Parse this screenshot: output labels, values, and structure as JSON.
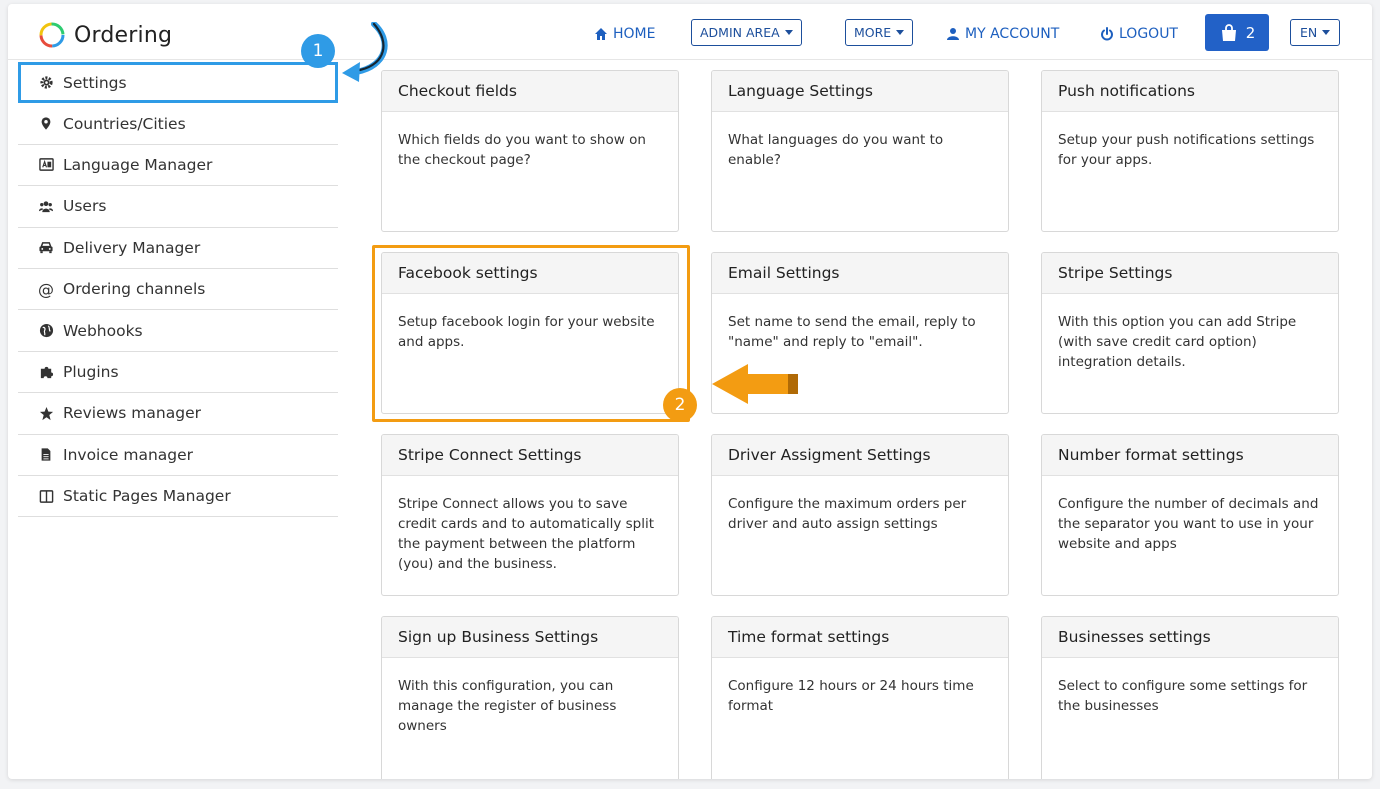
{
  "app": {
    "name": "Ordering"
  },
  "nav": {
    "home": "HOME",
    "admin_area": "ADMIN AREA",
    "more": "MORE",
    "my_account": "MY ACCOUNT",
    "logout": "LOGOUT",
    "cart_count": "2",
    "language": "EN"
  },
  "sidebar": {
    "items": [
      {
        "label": "Settings",
        "icon": "gear-icon"
      },
      {
        "label": "Countries/Cities",
        "icon": "map-marker-icon"
      },
      {
        "label": "Language Manager",
        "icon": "language-icon"
      },
      {
        "label": "Users",
        "icon": "users-icon"
      },
      {
        "label": "Delivery Manager",
        "icon": "car-icon"
      },
      {
        "label": "Ordering channels",
        "icon": "at-icon"
      },
      {
        "label": "Webhooks",
        "icon": "globe-icon"
      },
      {
        "label": "Plugins",
        "icon": "puzzle-icon"
      },
      {
        "label": "Reviews manager",
        "icon": "star-icon"
      },
      {
        "label": "Invoice manager",
        "icon": "file-icon"
      },
      {
        "label": "Static Pages Manager",
        "icon": "columns-icon"
      }
    ]
  },
  "cards": [
    {
      "title": "Checkout fields",
      "description": "Which fields do you want to show on the checkout page?"
    },
    {
      "title": "Language Settings",
      "description": "What languages do you want to enable?"
    },
    {
      "title": "Push notifications",
      "description": "Setup your push notifications settings for your apps."
    },
    {
      "title": "Facebook settings",
      "description": "Setup facebook login for your website and apps."
    },
    {
      "title": "Email Settings",
      "description": "Set name to send the email, reply to \"name\" and reply to \"email\"."
    },
    {
      "title": "Stripe Settings",
      "description": "With this option you can add Stripe (with save credit card option) integration details."
    },
    {
      "title": "Stripe Connect Settings",
      "description": "Stripe Connect allows you to save credit cards and to automatically split the payment between the platform (you) and the business."
    },
    {
      "title": "Driver Assigment Settings",
      "description": "Configure the maximum orders per driver and auto assign settings"
    },
    {
      "title": "Number format settings",
      "description": "Configure the number of decimals and the separator you want to use in your website and apps"
    },
    {
      "title": "Sign up Business Settings",
      "description": "With this configuration, you can manage the register of business owners"
    },
    {
      "title": "Time format settings",
      "description": "Configure 12 hours or 24 hours time format"
    },
    {
      "title": "Businesses settings",
      "description": "Select to configure some settings for the businesses"
    }
  ],
  "annotations": {
    "step1": "1",
    "step2": "2"
  },
  "colors": {
    "accent_blue": "#2f9be6",
    "accent_orange": "#f39c12",
    "nav_blue": "#1d5fbf",
    "cart_blue": "#2261c7"
  }
}
